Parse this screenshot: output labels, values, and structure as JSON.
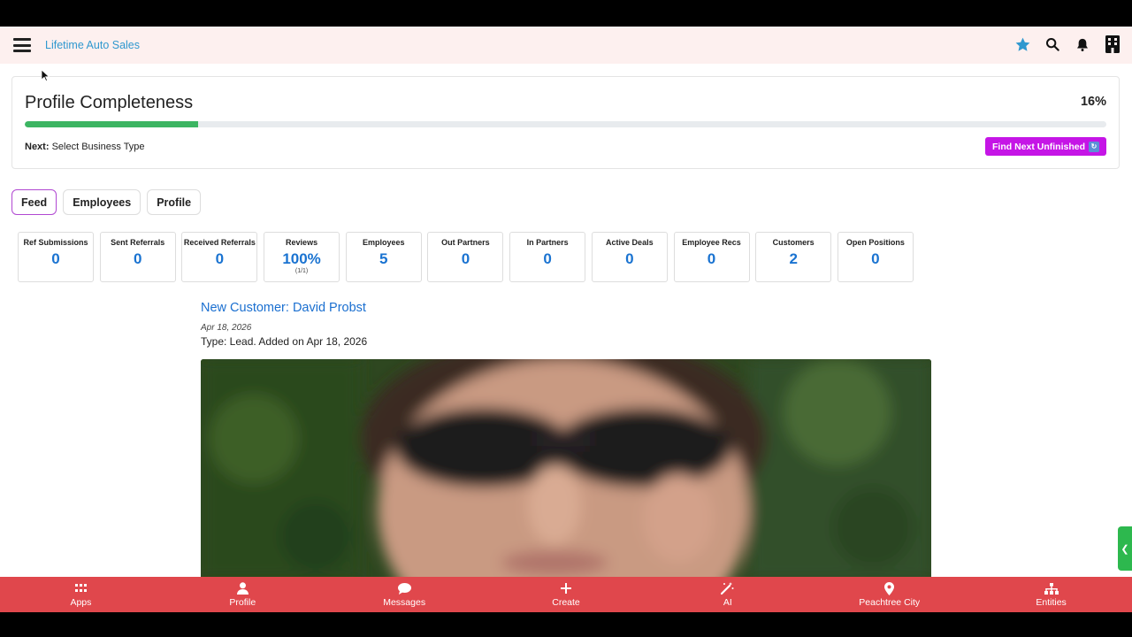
{
  "app": {
    "brand": "Lifetime Auto Sales"
  },
  "profile_completeness": {
    "title": "Profile Completeness",
    "percent_label": "16%",
    "progress": 0.16,
    "next_label": "Next:",
    "next_value": "Select Business Type",
    "find_button": "Find Next Unfinished"
  },
  "tabs": [
    {
      "label": "Feed",
      "active": true
    },
    {
      "label": "Employees",
      "active": false
    },
    {
      "label": "Profile",
      "active": false
    }
  ],
  "stats": [
    {
      "label": "Ref Submissions",
      "value": "0"
    },
    {
      "label": "Sent Referrals",
      "value": "0"
    },
    {
      "label": "Received Referrals",
      "value": "0"
    },
    {
      "label": "Reviews",
      "value": "100%",
      "sub": "(1/1)"
    },
    {
      "label": "Employees",
      "value": "5"
    },
    {
      "label": "Out Partners",
      "value": "0"
    },
    {
      "label": "In Partners",
      "value": "0"
    },
    {
      "label": "Active Deals",
      "value": "0"
    },
    {
      "label": "Employee Recs",
      "value": "0"
    },
    {
      "label": "Customers",
      "value": "2"
    },
    {
      "label": "Open Positions",
      "value": "0"
    }
  ],
  "feed_post": {
    "title": "New Customer: David Probst",
    "date": "Apr 18, 2026",
    "type_line": "Type: Lead. Added on Apr 18, 2026"
  },
  "bottom_nav": [
    {
      "label": "Apps",
      "icon": "grid-icon"
    },
    {
      "label": "Profile",
      "icon": "user-icon"
    },
    {
      "label": "Messages",
      "icon": "chat-icon"
    },
    {
      "label": "Create",
      "icon": "plus-icon"
    },
    {
      "label": "AI",
      "icon": "magic-wand-icon"
    },
    {
      "label": "Peachtree City",
      "icon": "map-pin-icon"
    },
    {
      "label": "Entities",
      "icon": "sitemap-icon"
    }
  ],
  "colors": {
    "brand": "#2f98cf",
    "progress_fill": "#3cb562",
    "find_button": "#c515e6",
    "stat_value": "#1a73d1",
    "bottom_bar": "#e0474c",
    "side_handle": "#2db84e"
  }
}
